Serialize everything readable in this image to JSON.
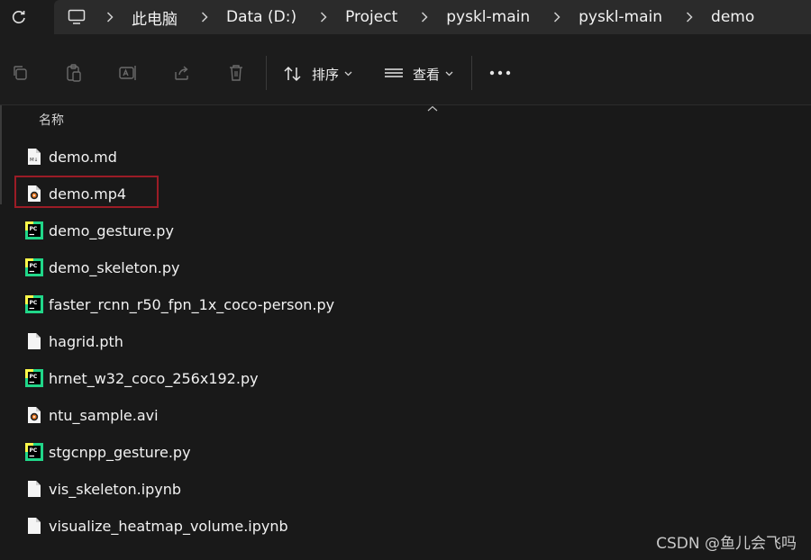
{
  "breadcrumb": [
    "此电脑",
    "Data (D:)",
    "Project",
    "pyskl-main",
    "pyskl-main",
    "demo"
  ],
  "toolbar": {
    "sort_label": "排序",
    "view_label": "查看",
    "icons": [
      "copy-icon",
      "paste-icon",
      "rename-icon",
      "share-icon",
      "delete-icon"
    ]
  },
  "list": {
    "column_name": "名称",
    "files": [
      {
        "name": "demo.md",
        "type": "markdown"
      },
      {
        "name": "demo.mp4",
        "type": "video"
      },
      {
        "name": "demo_gesture.py",
        "type": "python"
      },
      {
        "name": "demo_skeleton.py",
        "type": "python"
      },
      {
        "name": "faster_rcnn_r50_fpn_1x_coco-person.py",
        "type": "python"
      },
      {
        "name": "hagrid.pth",
        "type": "file"
      },
      {
        "name": "hrnet_w32_coco_256x192.py",
        "type": "python"
      },
      {
        "name": "ntu_sample.avi",
        "type": "video"
      },
      {
        "name": "stgcnpp_gesture.py",
        "type": "python"
      },
      {
        "name": "vis_skeleton.ipynb",
        "type": "file"
      },
      {
        "name": "visualize_heatmap_volume.ipynb",
        "type": "file"
      }
    ]
  },
  "watermark": "CSDN @鱼儿会飞吗",
  "colors": {
    "highlight": "#9b1c26",
    "pycharm_green": "#21d789"
  }
}
